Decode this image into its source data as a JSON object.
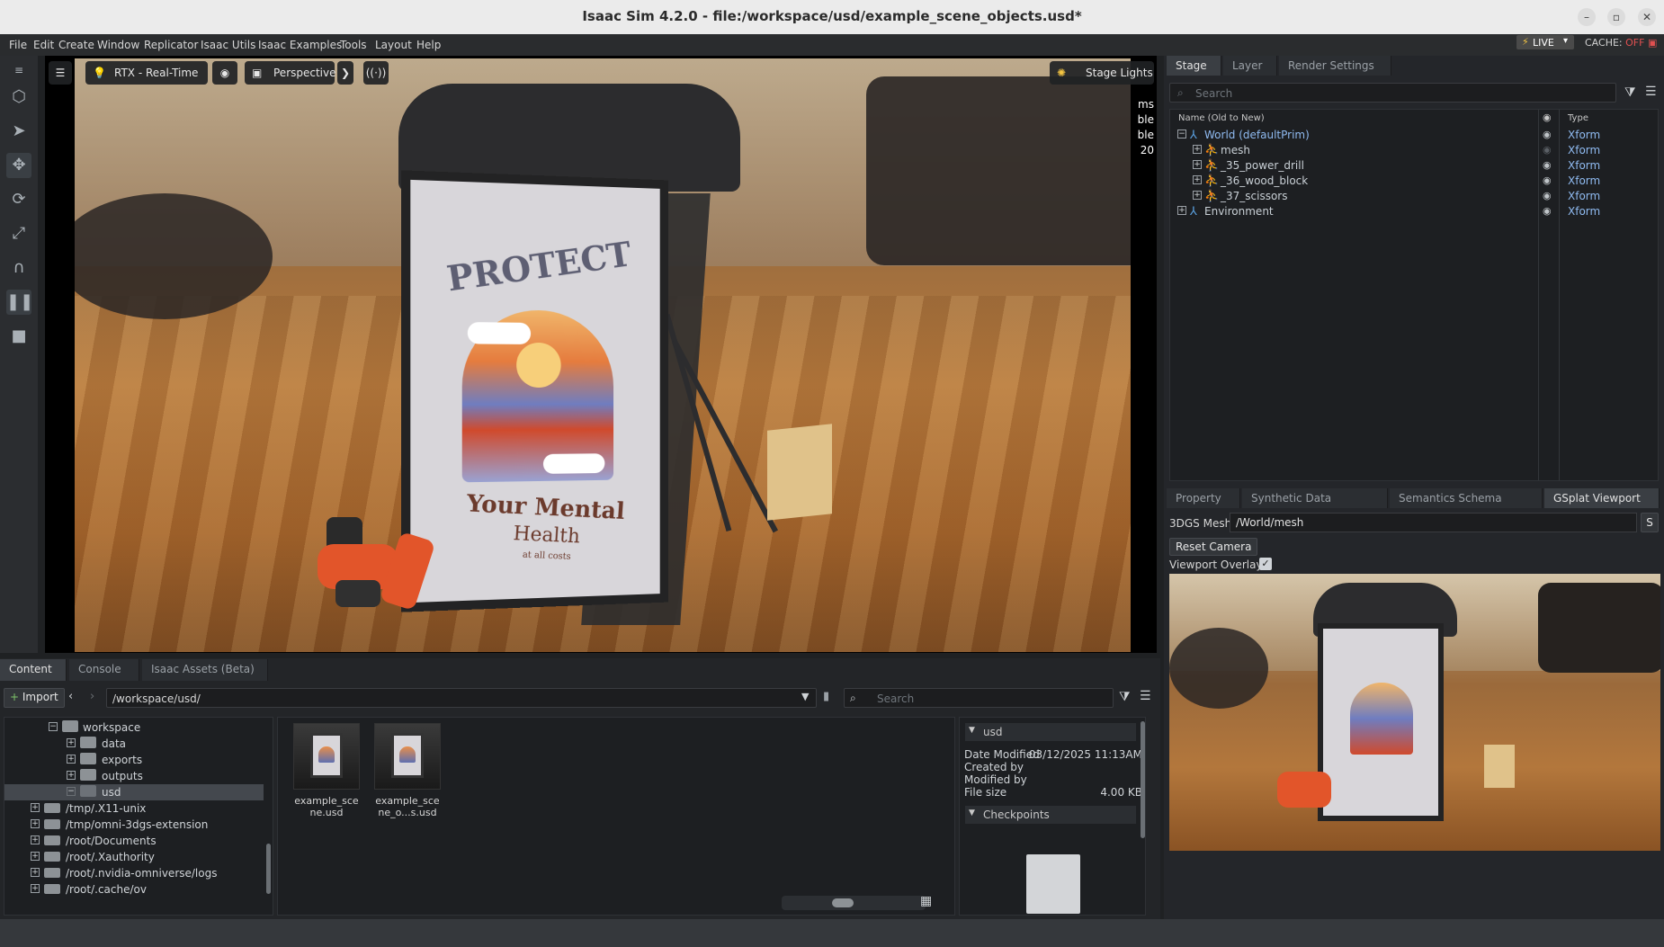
{
  "window": {
    "title": "Isaac Sim 4.2.0 - file:/workspace/usd/example_scene_objects.usd*"
  },
  "menu": [
    "File",
    "Edit",
    "Create",
    "Window",
    "Replicator",
    "Isaac Utils",
    "Isaac Examples",
    "Tools",
    "Layout",
    "Help"
  ],
  "live": {
    "label": "LIVE",
    "cache_label": "CACHE:",
    "cache_state": "OFF"
  },
  "viewport": {
    "render_mode": "RTX - Real-Time",
    "camera": "Perspective",
    "lights": "Stage Lights",
    "stats": [
      "ms",
      "ble",
      "ble",
      "20"
    ],
    "poster": {
      "line1": "PROTECT",
      "line2": "Your Mental",
      "line3": "Health",
      "line4": "at all costs"
    }
  },
  "stage": {
    "tabs": [
      "Stage",
      "Layer",
      "Render Settings"
    ],
    "search_placeholder": "Search",
    "col_name": "Name (Old to New)",
    "col_type": "Type",
    "rows": [
      {
        "name": "World (defaultPrim)",
        "type": "Xform"
      },
      {
        "name": "mesh",
        "type": "Xform"
      },
      {
        "name": "_35_power_drill",
        "type": "Xform"
      },
      {
        "name": "_36_wood_block",
        "type": "Xform"
      },
      {
        "name": "_37_scissors",
        "type": "Xform"
      },
      {
        "name": "Environment",
        "type": "Xform"
      }
    ]
  },
  "props": {
    "tabs": [
      "Property",
      "Synthetic Data Recorder",
      "Semantics Schema Editor",
      "GSplat Viewport"
    ],
    "mesh_label": "3DGS Mesh",
    "mesh_path": "/World/mesh",
    "side_btn": "S",
    "reset_camera": "Reset Camera",
    "overlay_label": "Viewport Overlay",
    "overlay_checked": true
  },
  "content": {
    "tabs": [
      "Content",
      "Console",
      "Isaac Assets (Beta)"
    ],
    "import_label": "Import",
    "path": "/workspace/usd/",
    "search_placeholder": "Search",
    "tree": [
      {
        "label": "workspace",
        "level": 1,
        "expanded": true
      },
      {
        "label": "data",
        "level": 2
      },
      {
        "label": "exports",
        "level": 2
      },
      {
        "label": "outputs",
        "level": 2
      },
      {
        "label": "usd",
        "level": 2,
        "selected": true
      },
      {
        "label": "/tmp/.X11-unix",
        "level": 0
      },
      {
        "label": "/tmp/omni-3dgs-extension",
        "level": 0
      },
      {
        "label": "/root/Documents",
        "level": 0
      },
      {
        "label": "/root/.Xauthority",
        "level": 0
      },
      {
        "label": "/root/.nvidia-omniverse/logs",
        "level": 0
      },
      {
        "label": "/root/.cache/ov",
        "level": 0
      }
    ],
    "files": [
      {
        "line1": "example_sce",
        "line2": "ne.usd"
      },
      {
        "line1": "example_sce",
        "line2": "ne_o...s.usd"
      }
    ],
    "info": {
      "name": "usd",
      "date_label": "Date Modified",
      "date": "03/12/2025 11:13AM",
      "created_by": "Created by",
      "modified_by": "Modified by",
      "file_size_label": "File size",
      "file_size": "4.00 KB",
      "checkpoints": "Checkpoints"
    }
  }
}
